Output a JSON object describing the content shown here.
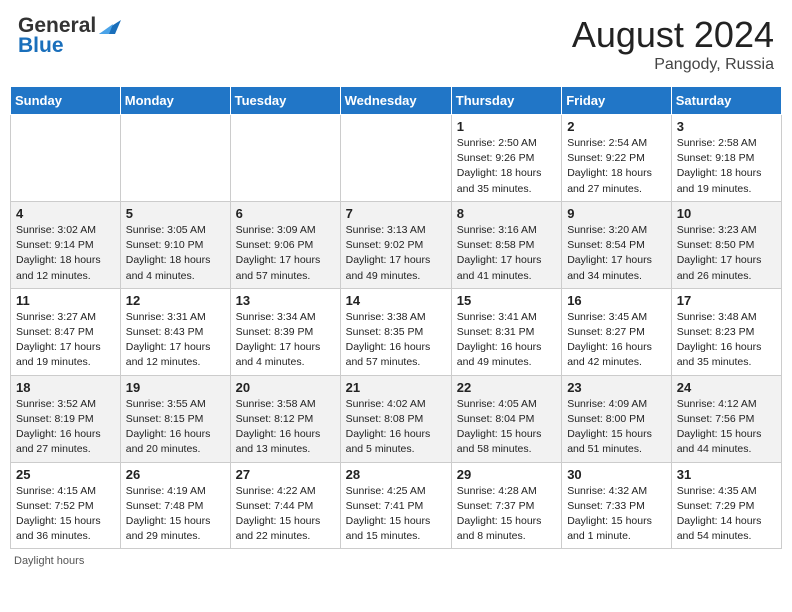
{
  "header": {
    "logo_general": "General",
    "logo_blue": "Blue",
    "month_year": "August 2024",
    "location": "Pangody, Russia"
  },
  "footer": {
    "daylight_hours": "Daylight hours"
  },
  "columns": [
    "Sunday",
    "Monday",
    "Tuesday",
    "Wednesday",
    "Thursday",
    "Friday",
    "Saturday"
  ],
  "weeks": [
    [
      {
        "day": "",
        "sunrise": "",
        "sunset": "",
        "daylight": ""
      },
      {
        "day": "",
        "sunrise": "",
        "sunset": "",
        "daylight": ""
      },
      {
        "day": "",
        "sunrise": "",
        "sunset": "",
        "daylight": ""
      },
      {
        "day": "",
        "sunrise": "",
        "sunset": "",
        "daylight": ""
      },
      {
        "day": "1",
        "sunrise": "Sunrise: 2:50 AM",
        "sunset": "Sunset: 9:26 PM",
        "daylight": "Daylight: 18 hours and 35 minutes."
      },
      {
        "day": "2",
        "sunrise": "Sunrise: 2:54 AM",
        "sunset": "Sunset: 9:22 PM",
        "daylight": "Daylight: 18 hours and 27 minutes."
      },
      {
        "day": "3",
        "sunrise": "Sunrise: 2:58 AM",
        "sunset": "Sunset: 9:18 PM",
        "daylight": "Daylight: 18 hours and 19 minutes."
      }
    ],
    [
      {
        "day": "4",
        "sunrise": "Sunrise: 3:02 AM",
        "sunset": "Sunset: 9:14 PM",
        "daylight": "Daylight: 18 hours and 12 minutes."
      },
      {
        "day": "5",
        "sunrise": "Sunrise: 3:05 AM",
        "sunset": "Sunset: 9:10 PM",
        "daylight": "Daylight: 18 hours and 4 minutes."
      },
      {
        "day": "6",
        "sunrise": "Sunrise: 3:09 AM",
        "sunset": "Sunset: 9:06 PM",
        "daylight": "Daylight: 17 hours and 57 minutes."
      },
      {
        "day": "7",
        "sunrise": "Sunrise: 3:13 AM",
        "sunset": "Sunset: 9:02 PM",
        "daylight": "Daylight: 17 hours and 49 minutes."
      },
      {
        "day": "8",
        "sunrise": "Sunrise: 3:16 AM",
        "sunset": "Sunset: 8:58 PM",
        "daylight": "Daylight: 17 hours and 41 minutes."
      },
      {
        "day": "9",
        "sunrise": "Sunrise: 3:20 AM",
        "sunset": "Sunset: 8:54 PM",
        "daylight": "Daylight: 17 hours and 34 minutes."
      },
      {
        "day": "10",
        "sunrise": "Sunrise: 3:23 AM",
        "sunset": "Sunset: 8:50 PM",
        "daylight": "Daylight: 17 hours and 26 minutes."
      }
    ],
    [
      {
        "day": "11",
        "sunrise": "Sunrise: 3:27 AM",
        "sunset": "Sunset: 8:47 PM",
        "daylight": "Daylight: 17 hours and 19 minutes."
      },
      {
        "day": "12",
        "sunrise": "Sunrise: 3:31 AM",
        "sunset": "Sunset: 8:43 PM",
        "daylight": "Daylight: 17 hours and 12 minutes."
      },
      {
        "day": "13",
        "sunrise": "Sunrise: 3:34 AM",
        "sunset": "Sunset: 8:39 PM",
        "daylight": "Daylight: 17 hours and 4 minutes."
      },
      {
        "day": "14",
        "sunrise": "Sunrise: 3:38 AM",
        "sunset": "Sunset: 8:35 PM",
        "daylight": "Daylight: 16 hours and 57 minutes."
      },
      {
        "day": "15",
        "sunrise": "Sunrise: 3:41 AM",
        "sunset": "Sunset: 8:31 PM",
        "daylight": "Daylight: 16 hours and 49 minutes."
      },
      {
        "day": "16",
        "sunrise": "Sunrise: 3:45 AM",
        "sunset": "Sunset: 8:27 PM",
        "daylight": "Daylight: 16 hours and 42 minutes."
      },
      {
        "day": "17",
        "sunrise": "Sunrise: 3:48 AM",
        "sunset": "Sunset: 8:23 PM",
        "daylight": "Daylight: 16 hours and 35 minutes."
      }
    ],
    [
      {
        "day": "18",
        "sunrise": "Sunrise: 3:52 AM",
        "sunset": "Sunset: 8:19 PM",
        "daylight": "Daylight: 16 hours and 27 minutes."
      },
      {
        "day": "19",
        "sunrise": "Sunrise: 3:55 AM",
        "sunset": "Sunset: 8:15 PM",
        "daylight": "Daylight: 16 hours and 20 minutes."
      },
      {
        "day": "20",
        "sunrise": "Sunrise: 3:58 AM",
        "sunset": "Sunset: 8:12 PM",
        "daylight": "Daylight: 16 hours and 13 minutes."
      },
      {
        "day": "21",
        "sunrise": "Sunrise: 4:02 AM",
        "sunset": "Sunset: 8:08 PM",
        "daylight": "Daylight: 16 hours and 5 minutes."
      },
      {
        "day": "22",
        "sunrise": "Sunrise: 4:05 AM",
        "sunset": "Sunset: 8:04 PM",
        "daylight": "Daylight: 15 hours and 58 minutes."
      },
      {
        "day": "23",
        "sunrise": "Sunrise: 4:09 AM",
        "sunset": "Sunset: 8:00 PM",
        "daylight": "Daylight: 15 hours and 51 minutes."
      },
      {
        "day": "24",
        "sunrise": "Sunrise: 4:12 AM",
        "sunset": "Sunset: 7:56 PM",
        "daylight": "Daylight: 15 hours and 44 minutes."
      }
    ],
    [
      {
        "day": "25",
        "sunrise": "Sunrise: 4:15 AM",
        "sunset": "Sunset: 7:52 PM",
        "daylight": "Daylight: 15 hours and 36 minutes."
      },
      {
        "day": "26",
        "sunrise": "Sunrise: 4:19 AM",
        "sunset": "Sunset: 7:48 PM",
        "daylight": "Daylight: 15 hours and 29 minutes."
      },
      {
        "day": "27",
        "sunrise": "Sunrise: 4:22 AM",
        "sunset": "Sunset: 7:44 PM",
        "daylight": "Daylight: 15 hours and 22 minutes."
      },
      {
        "day": "28",
        "sunrise": "Sunrise: 4:25 AM",
        "sunset": "Sunset: 7:41 PM",
        "daylight": "Daylight: 15 hours and 15 minutes."
      },
      {
        "day": "29",
        "sunrise": "Sunrise: 4:28 AM",
        "sunset": "Sunset: 7:37 PM",
        "daylight": "Daylight: 15 hours and 8 minutes."
      },
      {
        "day": "30",
        "sunrise": "Sunrise: 4:32 AM",
        "sunset": "Sunset: 7:33 PM",
        "daylight": "Daylight: 15 hours and 1 minute."
      },
      {
        "day": "31",
        "sunrise": "Sunrise: 4:35 AM",
        "sunset": "Sunset: 7:29 PM",
        "daylight": "Daylight: 14 hours and 54 minutes."
      }
    ]
  ]
}
